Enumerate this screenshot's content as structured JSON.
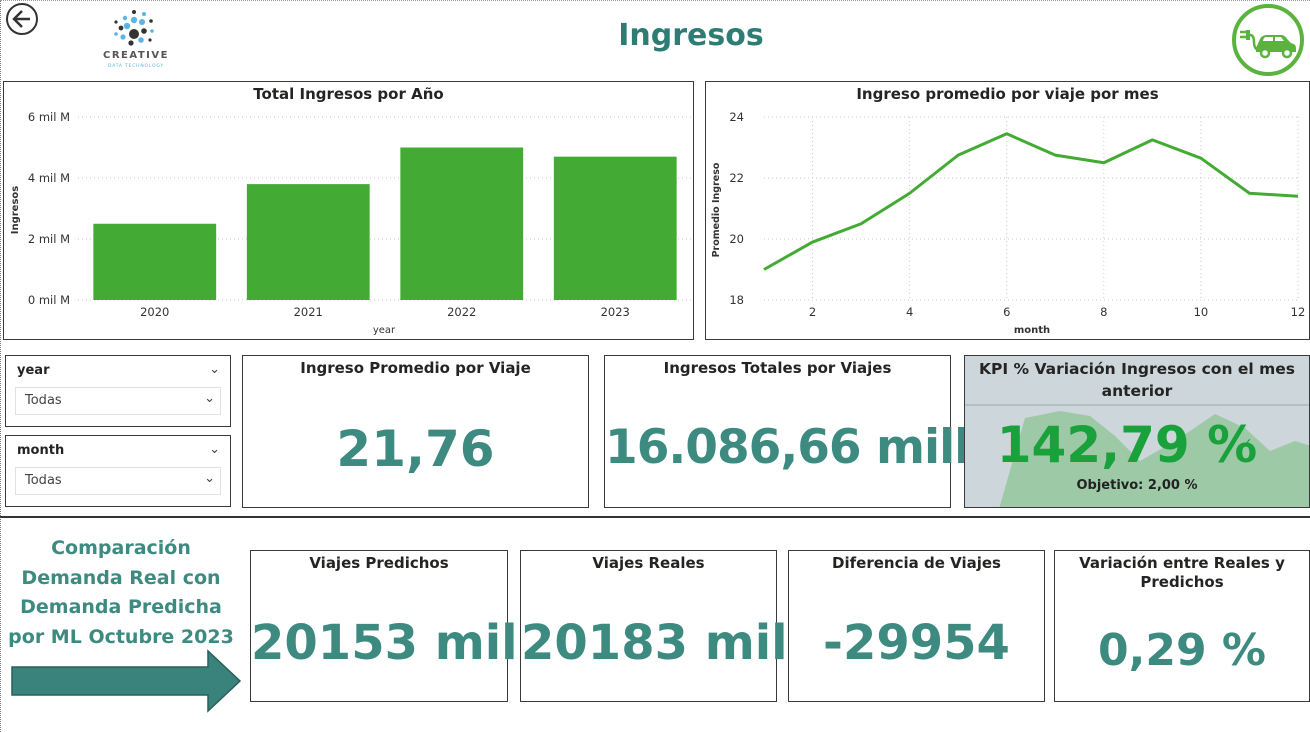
{
  "header": {
    "title": "Ingresos",
    "logo_word": "CREATIVE",
    "logo_sub": "DATA TECHNOLOGY",
    "back_icon": "back-arrow-icon",
    "car_icon": "electric-car-icon"
  },
  "colors": {
    "accent": "#3d8a80",
    "bar": "#43ab33",
    "line": "#43ab33",
    "logo_ring": "#5bb33e"
  },
  "bar_chart": {
    "title": "Total Ingresos por Año",
    "xlabel": "year",
    "ylabel": "Ingresos",
    "ticks": [
      "0 mil M",
      "2 mil M",
      "4 mil M",
      "6 mil M"
    ]
  },
  "line_chart": {
    "title": "Ingreso promedio por viaje por mes",
    "xlabel": "month",
    "ylabel": "Promedio Ingreso",
    "yticks": [
      "18",
      "20",
      "22",
      "24"
    ],
    "xticks": [
      "2",
      "4",
      "6",
      "8",
      "10",
      "12"
    ]
  },
  "chart_data": [
    {
      "type": "bar",
      "title": "Total Ingresos por Año",
      "categories": [
        "2020",
        "2021",
        "2022",
        "2023"
      ],
      "values": [
        2.5,
        3.8,
        5.0,
        4.7
      ],
      "unit": "mil M",
      "xlabel": "year",
      "ylabel": "Ingresos",
      "ylim": [
        0,
        6
      ],
      "grid": true
    },
    {
      "type": "line",
      "title": "Ingreso promedio por viaje por mes",
      "x": [
        1,
        2,
        3,
        4,
        5,
        6,
        7,
        8,
        9,
        10,
        11,
        12
      ],
      "y": [
        19.0,
        19.9,
        20.5,
        21.5,
        22.75,
        23.45,
        22.75,
        22.5,
        23.25,
        22.65,
        21.5,
        21.4
      ],
      "xlabel": "month",
      "ylabel": "Promedio Ingreso",
      "xlim": [
        1,
        12
      ],
      "ylim": [
        18,
        24
      ],
      "grid": true
    }
  ],
  "slicers": {
    "year": {
      "label": "year",
      "value": "Todas"
    },
    "month": {
      "label": "month",
      "value": "Todas"
    }
  },
  "cards": {
    "avg": {
      "title": "Ingreso Promedio por Viaje",
      "value": "21,76"
    },
    "total": {
      "title": "Ingresos Totales por Viajes",
      "value": "16.086,66 mill."
    },
    "kpi": {
      "title": "KPI % Variación Ingresos con el mes anterior",
      "value": "142,79 %",
      "target": "Objetivo: 2,00 %"
    }
  },
  "comparison": {
    "text": "Comparación Demanda Real con Demanda Predicha por ML Octubre 2023",
    "arrow_icon": "right-arrow-icon",
    "predicted": {
      "title": "Viajes Predichos",
      "value": "20153 mil"
    },
    "real": {
      "title": "Viajes Reales",
      "value": "20183 mil"
    },
    "diff": {
      "title": "Diferencia de Viajes",
      "value": "-29954"
    },
    "variation": {
      "title": "Variación entre Reales y Predichos",
      "value": "0,29 %"
    }
  }
}
